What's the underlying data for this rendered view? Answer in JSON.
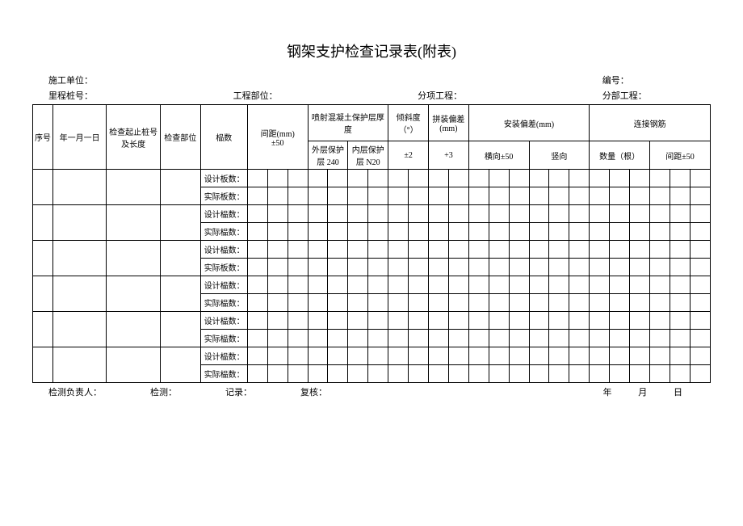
{
  "title": "钢架支护检查记录表(附表)",
  "header": {
    "unit_label": "施工单位：",
    "number_label": "编号：",
    "mileage_label": "里程桩号：",
    "part_label": "工程部位：",
    "subitem_label": "分项工程：",
    "section_label": "分部工程："
  },
  "table_headers": {
    "seq": "序号",
    "date": "年一月一日",
    "check_range": "检查起止桩号及长度",
    "check_part": "检查部位",
    "fushu": "榀数",
    "spacing": "间距(mm)",
    "spacing_tol": "±50",
    "protect_thickness": "喷射混凝土保护层厚度",
    "outer_protect": "外层保护层 240",
    "inner_protect": "内层保护层 N20",
    "tilt": "倾斜度（°）",
    "tilt_tol": "±2",
    "assembly_dev": "拼装偏差(mm)",
    "assembly_tol": "+3",
    "install_dev": "安装偏差(mm)",
    "horizontal": "横向±50",
    "vertical": "竖向",
    "connect_rebar": "连接钢筋",
    "quantity": "数量（根）",
    "conn_spacing": "间距±50"
  },
  "row_labels": [
    {
      "design": "设计板数：",
      "actual": "实际板数："
    },
    {
      "design": "设计榀数：",
      "actual": "实际榀数："
    },
    {
      "design": "设计榀数：",
      "actual": "实际板数："
    },
    {
      "design": "设计榀数：",
      "actual": "实际榀数："
    },
    {
      "design": "设计榀数：",
      "actual": "实际榀数："
    },
    {
      "design": "设计榀数：",
      "actual": "实际榀数："
    }
  ],
  "footer": {
    "responsible": "检测负责人：",
    "inspect": "检测：",
    "record": "记录：",
    "review": "复核：",
    "year": "年",
    "month": "月",
    "day": "日"
  }
}
